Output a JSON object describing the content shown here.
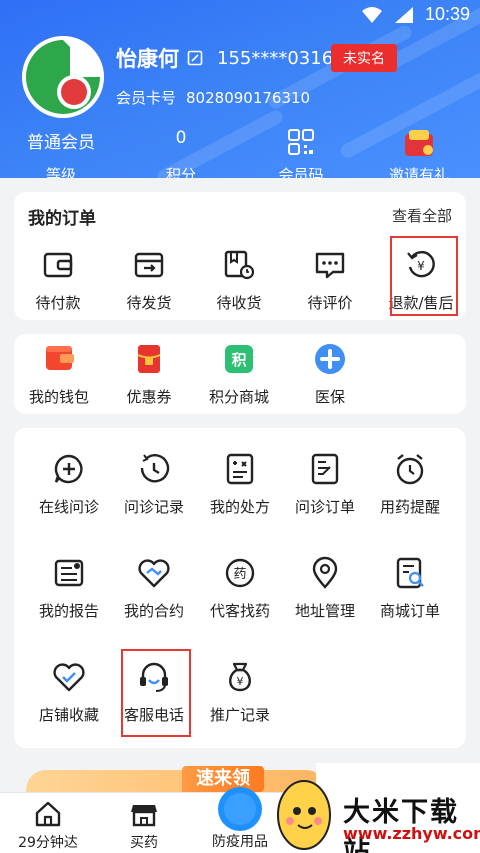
{
  "status": {
    "time": "10:39"
  },
  "profile": {
    "name": "怡康何",
    "phone": "155****0316",
    "verify_badge": "未实名",
    "card_label": "会员卡号",
    "card_number": "8028090176310"
  },
  "stats": [
    {
      "value": "普通会员",
      "label": "等级"
    },
    {
      "value": "0",
      "label": "积分"
    },
    {
      "value": "",
      "label": "会员码"
    },
    {
      "value": "",
      "label": "邀请有礼"
    }
  ],
  "orders": {
    "title": "我的订单",
    "more": "查看全部",
    "items": [
      {
        "label": "待付款",
        "icon": "wallet-icon"
      },
      {
        "label": "待发货",
        "icon": "box-icon"
      },
      {
        "label": "待收货",
        "icon": "receive-icon"
      },
      {
        "label": "待评价",
        "icon": "comment-icon"
      },
      {
        "label": "退款/售后",
        "icon": "refund-icon"
      }
    ]
  },
  "assets": [
    {
      "label": "我的钱包",
      "icon": "wallet-icon"
    },
    {
      "label": "优惠券",
      "icon": "coupon-icon"
    },
    {
      "label": "积分商城",
      "icon": "points-icon",
      "glyph": "积"
    },
    {
      "label": "医保",
      "icon": "medical-insurance-icon"
    }
  ],
  "services": [
    {
      "label": "在线问诊",
      "icon": "chat-plus-icon"
    },
    {
      "label": "问诊记录",
      "icon": "history-icon"
    },
    {
      "label": "我的处方",
      "icon": "prescription-icon"
    },
    {
      "label": "问诊订单",
      "icon": "consult-order-icon"
    },
    {
      "label": "用药提醒",
      "icon": "alarm-icon"
    },
    {
      "label": "我的报告",
      "icon": "report-icon"
    },
    {
      "label": "我的合约",
      "icon": "handshake-icon"
    },
    {
      "label": "代客找药",
      "icon": "find-drug-icon",
      "glyph": "药"
    },
    {
      "label": "地址管理",
      "icon": "location-icon"
    },
    {
      "label": "商城订单",
      "icon": "mall-order-icon"
    },
    {
      "label": "店铺收藏",
      "icon": "heart-check-icon"
    },
    {
      "label": "客服电话",
      "icon": "headset-icon"
    },
    {
      "label": "推广记录",
      "icon": "money-bag-icon"
    }
  ],
  "promo": {
    "tag": "速来领"
  },
  "tabbar": [
    {
      "label": "29分钟达",
      "icon": "home-icon"
    },
    {
      "label": "买药",
      "icon": "shop-icon"
    },
    {
      "label": "防疫用品",
      "icon": "epidemic-icon"
    }
  ],
  "watermark": {
    "title": "大米下载站",
    "url": "www.zzhyw.com"
  },
  "colors": {
    "brand": "#3b82f6",
    "badge": "#ea2d2d",
    "highlight": "#e53935"
  }
}
